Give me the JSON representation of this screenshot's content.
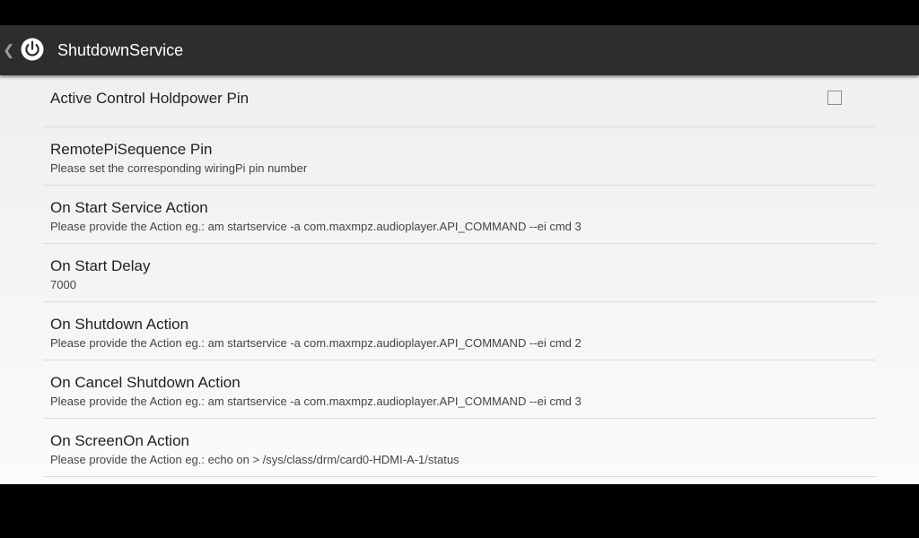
{
  "app": {
    "title": "ShutdownService",
    "up_icon": "chevron-left-icon",
    "app_icon": "power-icon"
  },
  "preferences": [
    {
      "title": "Active Control Holdpower Pin",
      "summary": "",
      "widget": "checkbox",
      "checked": false
    },
    {
      "title": "RemotePiSequence Pin",
      "summary": "Please set the corresponding wiringPi pin number"
    },
    {
      "title": "On Start Service Action",
      "summary": "Please provide the Action eg.: am startservice -a com.maxmpz.audioplayer.API_COMMAND --ei cmd 3"
    },
    {
      "title": "On Start Delay",
      "summary": "7000"
    },
    {
      "title": "On Shutdown Action",
      "summary": "Please provide the Action eg.: am startservice -a com.maxmpz.audioplayer.API_COMMAND --ei cmd 2"
    },
    {
      "title": "On Cancel Shutdown Action",
      "summary": "Please provide the Action eg.: am startservice -a com.maxmpz.audioplayer.API_COMMAND --ei cmd 3"
    },
    {
      "title": "On ScreenOn Action",
      "summary": "Please provide the Action eg.: echo on > /sys/class/drm/card0-HDMI-A-1/status"
    }
  ],
  "colors": {
    "action_bar": "#2d2d2d",
    "background": "#f2f2f2",
    "divider": "#dcdcdc",
    "title_text": "#222222",
    "summary_text": "#444444"
  }
}
